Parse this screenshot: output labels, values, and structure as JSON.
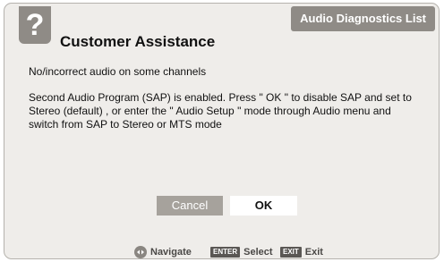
{
  "header": {
    "icon_glyph": "?",
    "icon_name": "question-icon",
    "title": "Customer Assistance",
    "list_tab": "Audio Diagnostics List"
  },
  "content": {
    "issue": "No/incorrect audio on some channels",
    "body": "Second Audio Program (SAP) is enabled.  Press \" OK \" to disable SAP and set to Stereo (default) ,  or enter the \" Audio Setup \" mode through Audio menu and switch from SAP to Stereo or MTS mode"
  },
  "buttons": {
    "cancel_label": "Cancel",
    "ok_label": "OK"
  },
  "footer": {
    "navigate_label": "Navigate",
    "enter_key": "ENTER",
    "select_label": "Select",
    "exit_key": "EXIT",
    "exit_label": "Exit"
  },
  "colors": {
    "panel_bg": "#efedea",
    "accent_gray": "#8f8b86",
    "ok_bg": "#ffffff"
  }
}
